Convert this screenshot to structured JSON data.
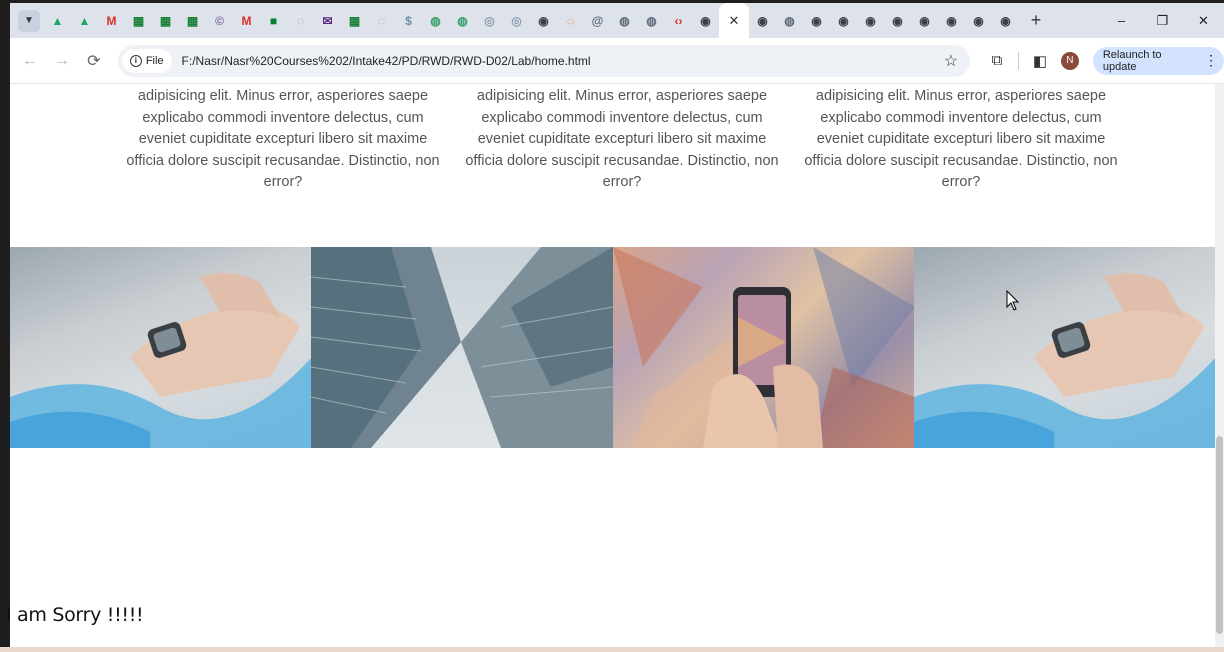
{
  "browser": {
    "tab_menu_icon": "chevron-down-icon",
    "tabs": [
      {
        "icon": "google-drive-icon",
        "color": "#1fa463",
        "glyph": "▲"
      },
      {
        "icon": "google-drive-icon",
        "color": "#1fa463",
        "glyph": "▲"
      },
      {
        "icon": "gmail-icon",
        "color": "#d93025",
        "glyph": "M"
      },
      {
        "icon": "sheets-icon",
        "color": "#188038",
        "glyph": "▦"
      },
      {
        "icon": "sheets-icon",
        "color": "#188038",
        "glyph": "▦"
      },
      {
        "icon": "sheets-icon",
        "color": "#188038",
        "glyph": "▦"
      },
      {
        "icon": "copyright-icon",
        "color": "#7b61a8",
        "glyph": "©"
      },
      {
        "icon": "gmail-icon",
        "color": "#d93025",
        "glyph": "M"
      },
      {
        "icon": "meet-icon",
        "color": "#00832d",
        "glyph": "■"
      },
      {
        "icon": "loading-icon",
        "color": "#9aa0a6",
        "glyph": "◌"
      },
      {
        "icon": "mail-icon",
        "color": "#5b2a86",
        "glyph": "✉"
      },
      {
        "icon": "sheets-icon",
        "color": "#188038",
        "glyph": "▦"
      },
      {
        "icon": "loading-icon",
        "color": "#9aa0a6",
        "glyph": "◌"
      },
      {
        "icon": "dollar-icon",
        "color": "#6f8fa8",
        "glyph": "$"
      },
      {
        "icon": "globe-icon",
        "color": "#3a9f6b",
        "glyph": "◍"
      },
      {
        "icon": "globe-icon",
        "color": "#3a9f6b",
        "glyph": "◍"
      },
      {
        "icon": "web-icon",
        "color": "#8aa0b0",
        "glyph": "◎"
      },
      {
        "icon": "web-icon",
        "color": "#8aa0b0",
        "glyph": "◎"
      },
      {
        "icon": "record-icon",
        "color": "#3c4043",
        "glyph": "◉"
      },
      {
        "icon": "loading-icon",
        "color": "#e37400",
        "glyph": "◌"
      },
      {
        "icon": "at-icon",
        "color": "#5f6b7a",
        "glyph": "@"
      },
      {
        "icon": "globe-icon",
        "color": "#5f6b7a",
        "glyph": "◍"
      },
      {
        "icon": "globe-icon",
        "color": "#5f6b7a",
        "glyph": "◍"
      },
      {
        "icon": "code-icon",
        "color": "#d93025",
        "glyph": "‹›"
      },
      {
        "icon": "chrome-icon",
        "color": "#3c4043",
        "glyph": "◉"
      },
      {
        "icon": "close-tab-icon",
        "color": "#3c4043",
        "glyph": "✕",
        "active": true
      },
      {
        "icon": "chrome-icon",
        "color": "#3c4043",
        "glyph": "◉"
      },
      {
        "icon": "globe-icon",
        "color": "#5f6b7a",
        "glyph": "◍"
      },
      {
        "icon": "chrome-icon",
        "color": "#3c4043",
        "glyph": "◉"
      },
      {
        "icon": "chrome-icon",
        "color": "#3c4043",
        "glyph": "◉"
      },
      {
        "icon": "chrome-icon",
        "color": "#3c4043",
        "glyph": "◉"
      },
      {
        "icon": "chrome-icon",
        "color": "#3c4043",
        "glyph": "◉"
      },
      {
        "icon": "chrome-icon",
        "color": "#3c4043",
        "glyph": "◉"
      },
      {
        "icon": "chrome-icon",
        "color": "#3c4043",
        "glyph": "◉"
      },
      {
        "icon": "chrome-icon",
        "color": "#3c4043",
        "glyph": "◉"
      },
      {
        "icon": "chrome-icon",
        "color": "#3c4043",
        "glyph": "◉"
      }
    ],
    "new_tab_glyph": "+",
    "window_controls": {
      "minimize": "–",
      "restore": "❐",
      "close": "✕"
    },
    "toolbar": {
      "back_glyph": "←",
      "forward_glyph": "→",
      "reload_glyph": "⟳",
      "site_info_label": "File",
      "url": "F:/Nasr/Nasr%20Courses%202/Intake42/PD/RWD/RWD-D02/Lab/home.html",
      "star_glyph": "☆",
      "extensions_glyph": "⧉",
      "sidepanel_glyph": "◧",
      "avatar_letter": "N",
      "relaunch_label": "Relaunch to update",
      "menu_glyph": "⋮"
    }
  },
  "page": {
    "columns": [
      {
        "text": "adipisicing elit. Minus error, asperiores saepe explicabo commodi inventore delectus, cum eveniet cupiditate excepturi libero sit maxime officia dolore suscipit recusandae. Distinctio, non error?"
      },
      {
        "text": "adipisicing elit. Minus error, asperiores saepe explicabo commodi inventore delectus, cum eveniet cupiditate excepturi libero sit maxime officia dolore suscipit recusandae. Distinctio, non error?"
      },
      {
        "text": "adipisicing elit. Minus error, asperiores saepe explicabo commodi inventore delectus, cum eveniet cupiditate excepturi libero sit maxime officia dolore suscipit recusandae. Distinctio, non error?"
      }
    ],
    "gallery": [
      {
        "subject": "smartwatch"
      },
      {
        "subject": "skyscrapers"
      },
      {
        "subject": "smartphone"
      },
      {
        "subject": "smartwatch"
      }
    ]
  },
  "overlay": {
    "caption": "I am Sorry !!!!!"
  }
}
